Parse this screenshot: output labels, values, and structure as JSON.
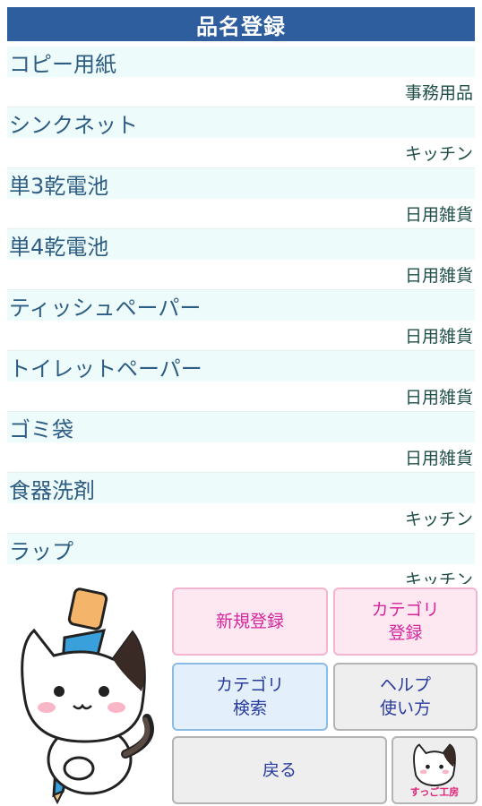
{
  "header": {
    "title": "品名登録"
  },
  "items": [
    {
      "name": "コピー用紙",
      "category": "事務用品"
    },
    {
      "name": "シンクネット",
      "category": "キッチン"
    },
    {
      "name": "単3乾電池",
      "category": "日用雑貨"
    },
    {
      "name": "単4乾電池",
      "category": "日用雑貨"
    },
    {
      "name": "ティッシュペーパー",
      "category": "日用雑貨"
    },
    {
      "name": "トイレットペーパー",
      "category": "日用雑貨"
    },
    {
      "name": "ゴミ袋",
      "category": "日用雑貨"
    },
    {
      "name": "食器洗剤",
      "category": "キッチン"
    },
    {
      "name": "ラップ",
      "category": "キッチン"
    }
  ],
  "buttons": {
    "new_register": "新規登録",
    "category_register": "カテゴリ\n登録",
    "category_search": "カテゴリ\n検索",
    "help": "ヘルプ\n使い方",
    "back": "戻る",
    "logo_text": "すっご工房"
  },
  "colors": {
    "header_bg": "#2f5e9e",
    "item_name": "#2e5d83",
    "item_category": "#1f4f48",
    "row_alt_bg": "#eefbfb",
    "pink_text": "#d4259a",
    "blue_text": "#283a9e"
  }
}
